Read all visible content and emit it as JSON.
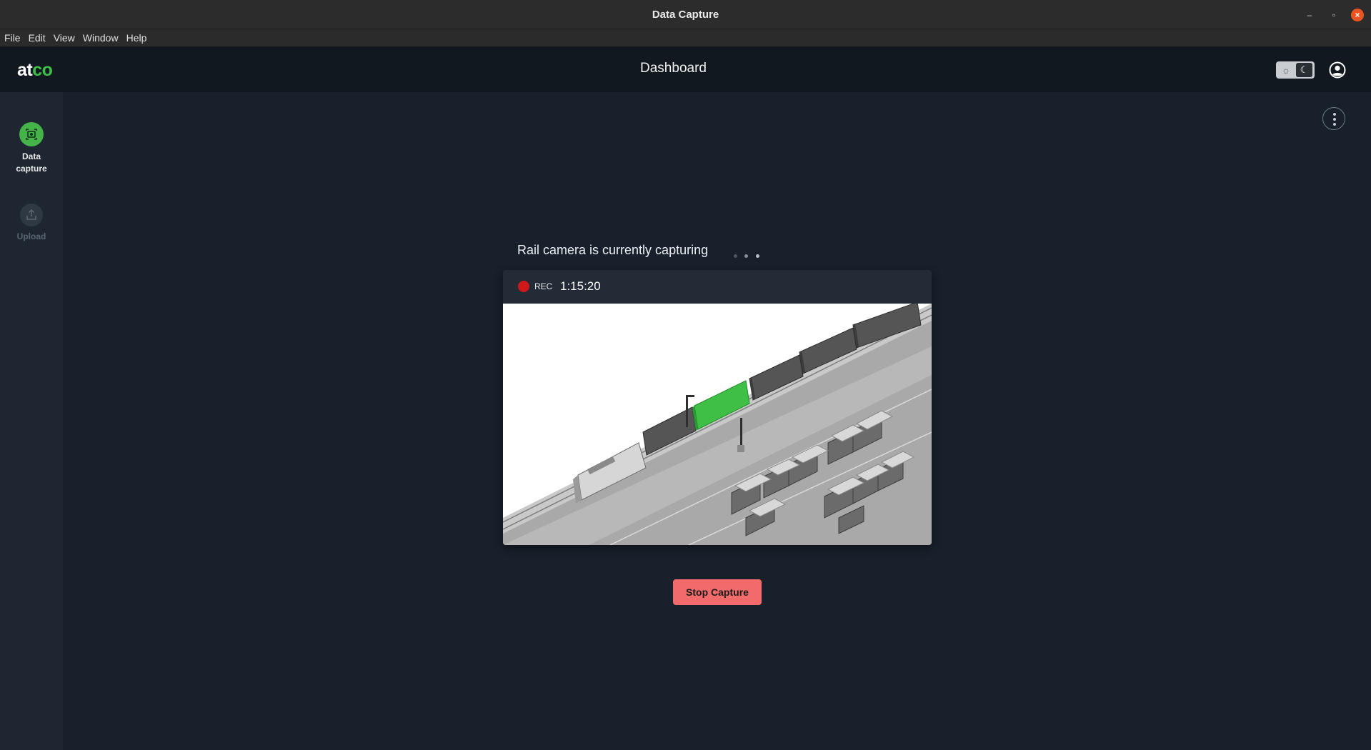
{
  "window": {
    "title": "Data Capture"
  },
  "menu": [
    "File",
    "Edit",
    "View",
    "Window",
    "Help"
  ],
  "header": {
    "logo_part1": "at",
    "logo_part2": "co",
    "title": "Dashboard",
    "theme_toggle": {
      "light_icon": "sun-icon",
      "dark_icon": "moon-icon",
      "selected": "dark"
    },
    "user_icon": "user-circle-icon"
  },
  "sidebar": {
    "items": [
      {
        "label_line1": "Data",
        "label_line2": "capture",
        "icon": "camera-scan-icon",
        "active": true
      },
      {
        "label": "Upload",
        "icon": "upload-icon",
        "active": false
      }
    ]
  },
  "main": {
    "more_icon": "more-vertical-icon",
    "status_text": "Rail camera is currently capturing",
    "rec_label": "REC",
    "rec_time": "1:15:20",
    "stop_button": "Stop Capture"
  },
  "colors": {
    "accent_green": "#45b34a",
    "rec_red": "#d0181c",
    "stop_button": "#f26b6b",
    "highlight_car": "#3fbf45"
  }
}
